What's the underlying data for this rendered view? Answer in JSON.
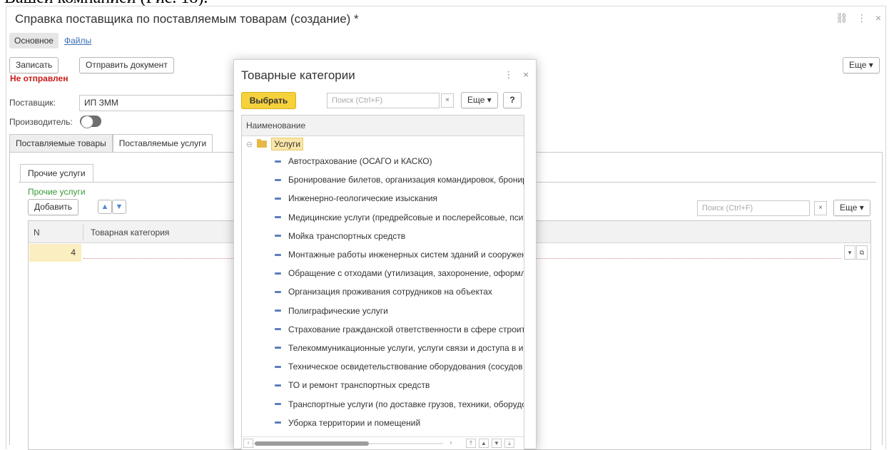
{
  "doc_fragment": "Вашей компанией (Рис. 18).",
  "form": {
    "title": "Справка поставщика по поставляемым товарам (создание) *",
    "window_icons": {
      "link": "⛓",
      "more": "⋮",
      "close": "×"
    },
    "nav": {
      "main": "Основное",
      "files": "Файлы"
    },
    "buttons": {
      "save": "Записать",
      "send": "Отправить документ",
      "more": "Еще ▾"
    },
    "status": "Не отправлен",
    "supplier_label": "Поставщик:",
    "supplier_value": "ИП ЗММ",
    "producer_label": "Производитель:",
    "tabs": [
      "Поставляемые товары",
      "Поставляемые услуги"
    ],
    "subtab": "Прочие услуги",
    "group_label": "Прочие услуги",
    "add_button": "Добавить",
    "search_placeholder": "Поиск (Ctrl+F)",
    "clear": "×",
    "more": "Еще ▾",
    "table": {
      "columns": [
        "N",
        "Товарная категория"
      ],
      "rows": [
        {
          "n": "4",
          "category": ""
        }
      ]
    }
  },
  "modal": {
    "title": "Товарные категории",
    "icons": {
      "more": "⋮",
      "close": "×"
    },
    "choose_button": "Выбрать",
    "search_placeholder": "Поиск (Ctrl+F)",
    "clear": "×",
    "more": "Еще ▾",
    "help": "?",
    "column": "Наименование",
    "root": "Услуги",
    "items": [
      "Автострахование (ОСАГО и КАСКО)",
      "Бронирование билетов, организация командировок, бронир",
      "Инженерно-геологические изыскания",
      "Медицинские услуги (предрейсовые и послерейсовые, пси",
      "Мойка транспортных средств",
      "Монтажные работы инженерных систем зданий и сооружен",
      "Обращение с отходами (утилизация, захоронение, оформл",
      "Организация проживания сотрудников на объектах",
      "Полиграфические услуги",
      "Страхование гражданской ответственности в сфере строит",
      "Телекоммуникационные услуги, услуги связи и доступа в и",
      "Техническое освидетельствование оборудования (сосудов",
      "ТО и ремонт транспортных средств",
      "Транспортные услуги (по доставке грузов, техники, оборудо",
      "Уборка территории и помещений"
    ]
  }
}
